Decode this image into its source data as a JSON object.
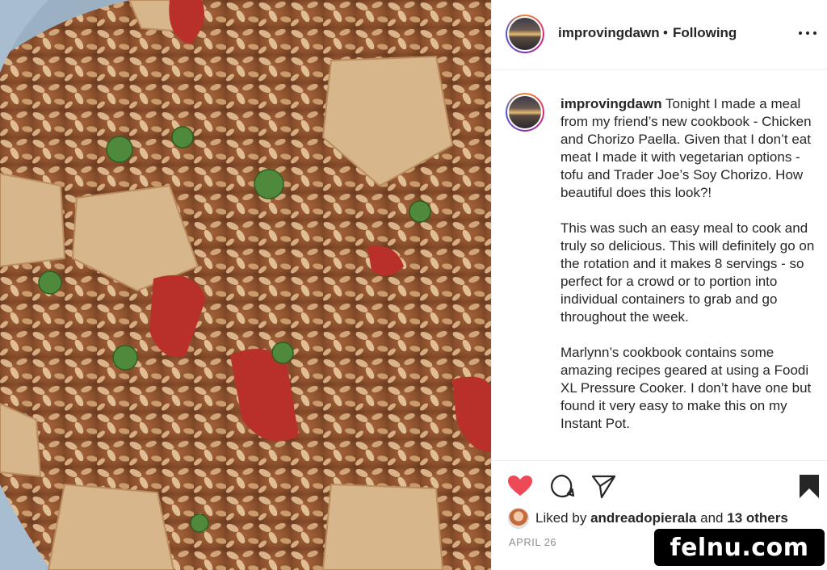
{
  "post": {
    "image_description_icon": "food-photo",
    "header": {
      "username": "improvingdawn",
      "separator": "•",
      "follow_status": "Following",
      "more_icon": "more-horizontal-icon"
    },
    "caption": {
      "username": "improvingdawn",
      "paragraphs": [
        "Tonight I made a meal from my friend’s new cookbook - Chicken and Chorizo Paella. Given that I don’t eat meat I made it with vegetarian options - tofu and Trader Joe’s Soy Chorizo. How beautiful does this look?!",
        "This was such an easy meal to cook and truly so delicious. This will definitely go on the rotation and it makes 8 servings - so perfect for a crowd or to portion into individual containers to grab and go throughout the week.",
        "Marlynn’s cookbook contains some amazing recipes geared at using a Foodi XL Pressure Cooker. I don’t have one but found it very easy to make this on my Instant Pot."
      ]
    },
    "actions": {
      "like_icon": "heart-icon",
      "like_state": "liked",
      "like_color": "#ed4956",
      "comment_icon": "comment-icon",
      "share_icon": "paper-plane-icon",
      "save_icon": "bookmark-icon"
    },
    "likes": {
      "prefix": "Liked by",
      "liker": "andreadopierala",
      "conjunction": "and",
      "others": "13 others"
    },
    "date": "APRIL 26"
  },
  "watermark": "felnu.com"
}
